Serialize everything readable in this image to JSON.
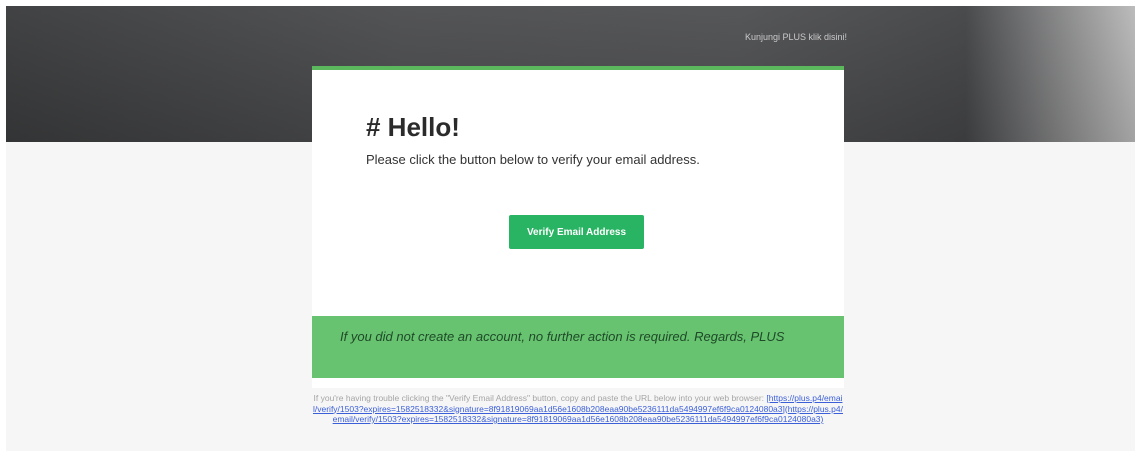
{
  "header": {
    "visit_link": "Kunjungi PLUS klik disini!"
  },
  "card": {
    "heading": "# Hello!",
    "intro": "Please click the button below to verify your email address.",
    "button_label": "Verify Email Address",
    "notice": "If you did not create an account, no further action is required. Regards, PLUS"
  },
  "footer": {
    "trouble_text": "If you're having trouble clicking the \"Verify Email Address\" button, copy and paste the URL below into your web browser: ",
    "url_link": "[https://plus.p4/email/verify/1503?expires=1582518332&signature=8f91819069aa1d56e1608b208eaa90be5236111da5494997ef6f9ca0124080a3](https://plus.p4/email/verify/1503?expires=1582518332&signature=8f91819069aa1d56e1608b208eaa90be5236111da5494997ef6f9ca0124080a3)"
  },
  "colors": {
    "accent_green": "#5cb85c",
    "button_green": "#28b463",
    "notice_green": "#67c370",
    "link_blue": "#3b5fd9"
  }
}
